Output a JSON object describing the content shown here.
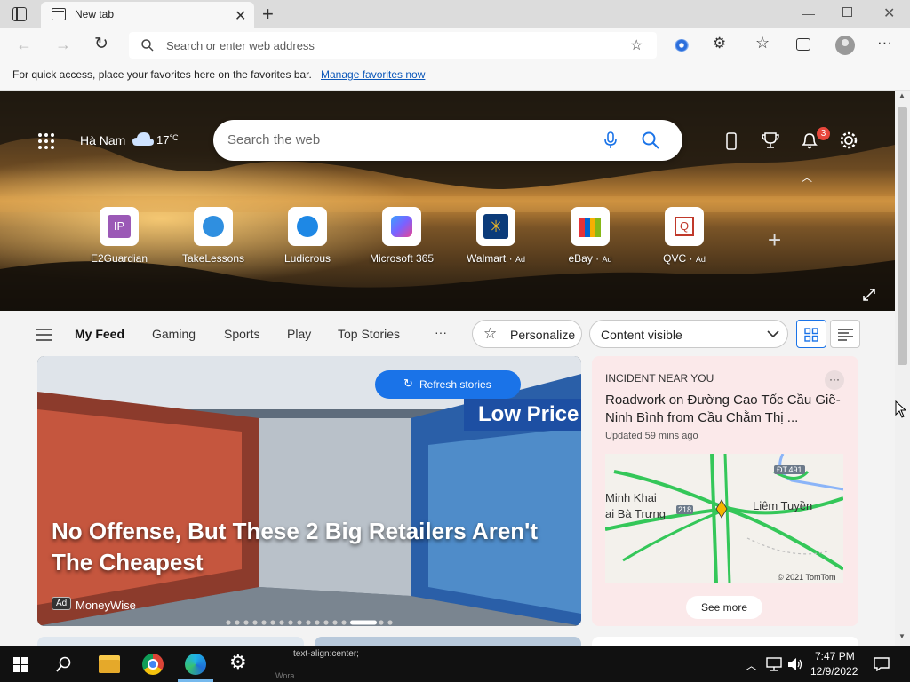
{
  "browser": {
    "tab_title": "New tab",
    "address_placeholder": "Search or enter web address",
    "favorites_bar_text": "For quick access, place your favorites here on the favorites bar.",
    "favorites_bar_link": "Manage favorites now"
  },
  "hero": {
    "location": "Hà Nam",
    "temperature": "17",
    "temp_unit": "°C",
    "search_placeholder": "Search the web",
    "notification_count": "3",
    "quick_links": [
      {
        "label": "E2Guardian",
        "ad": "",
        "icon": "IP",
        "color": "#9b59b6"
      },
      {
        "label": "TakeLessons",
        "ad": "",
        "icon": "takelessons-icon",
        "color": "#2f8fe0"
      },
      {
        "label": "Ludicrous",
        "ad": "",
        "icon": "ludicrous-icon",
        "color": "#1e88e5"
      },
      {
        "label": "Microsoft 365",
        "ad": "",
        "icon": "microsoft365-icon",
        "color": "#7b61ff"
      },
      {
        "label": "Walmart",
        "ad": "Ad",
        "icon": "walmart-icon",
        "color": "#0b3b7a"
      },
      {
        "label": "eBay",
        "ad": "Ad",
        "icon": "ebay-icon",
        "color": "#e53238"
      },
      {
        "label": "QVC",
        "ad": "Ad",
        "icon": "Q",
        "color": "#c0392b"
      }
    ]
  },
  "feed_nav": {
    "items": [
      "My Feed",
      "Gaming",
      "Sports",
      "Play",
      "Top Stories"
    ],
    "more": "···",
    "personalize": "Personalize",
    "content_select": "Content visible"
  },
  "main_card": {
    "refresh_label": "Refresh stories",
    "headline": "No Offense, But These 2 Big Retailers Aren't The Cheapest",
    "ad_badge": "Ad",
    "source": "MoneyWise",
    "store_sign": "Low Price"
  },
  "side_card": {
    "category": "INCIDENT NEAR YOU",
    "more": "···",
    "title": "Roadwork on Đường Cao Tốc Cầu Giẽ-Ninh Bình from Cầu Chằm Thị ...",
    "updated": "Updated 59 mins ago",
    "map_labels": [
      "Minh Khai",
      "ai Bà Trưng",
      "Liêm Tuyền",
      "ĐT.491",
      "218",
      "© 2021 TomTom"
    ],
    "see_more": "See more"
  },
  "taskbar": {
    "time": "7:47 PM",
    "date": "12/9/2022",
    "tooltip_line1": "text-align:center;",
    "tooltip_line2": "Wora",
    "tray_lang": "",
    "accent": "#0078d4"
  }
}
